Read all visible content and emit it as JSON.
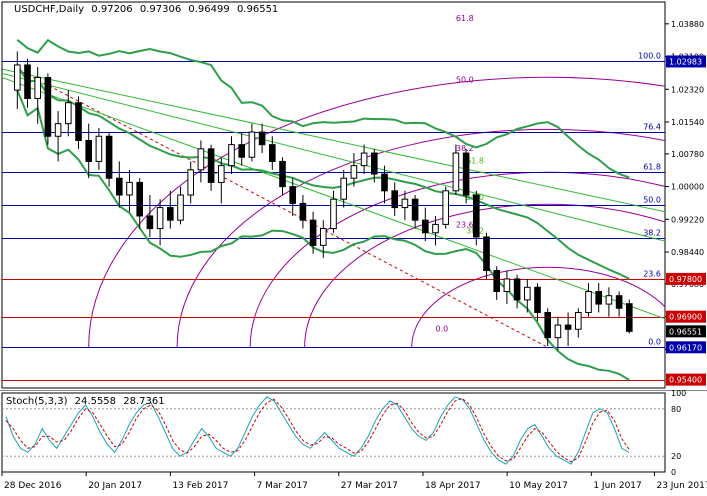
{
  "header": {
    "symbol": "USDCHF,Daily",
    "open": "0.97206",
    "high": "0.97306",
    "low": "0.96499",
    "close": "0.96551"
  },
  "stoch_header": {
    "name": "Stoch(5,3,3)",
    "main": "24.5558",
    "signal": "28.7361"
  },
  "colors": {
    "background": "#ffffff",
    "candle": "#000000",
    "bollinger": "#2e9e4a",
    "fan": "#33bb33",
    "fib_level": "#0000aa",
    "red_level": "#cc0000",
    "arc": "#990099",
    "stoch_main": "#1aa3b8",
    "stoch_signal": "#cc0000"
  },
  "chart_data": [
    {
      "type": "candlestick",
      "title": "USDCHF,Daily",
      "ylim": [
        0.952,
        1.044
      ],
      "price_ticks": [
        "1.03880",
        "1.03100",
        "1.02320",
        "1.01540",
        "1.00780",
        "1.00000",
        "0.99220",
        "0.98440",
        "0.97680",
        "0.96900",
        "0.96120"
      ],
      "x_ticks": [
        "28 Dec 2016",
        "20 Jan 2017",
        "13 Feb 2017",
        "7 Mar 2017",
        "27 Mar 2017",
        "18 Apr 2017",
        "10 May 2017",
        "1 Jun 2017",
        "23 Jun 2017"
      ],
      "horizontal_levels": [
        {
          "label": "100.0",
          "price": 1.02983,
          "tag": "1.02983",
          "kind": "fib"
        },
        {
          "label": "76.4",
          "price": 1.013,
          "kind": "fib"
        },
        {
          "label": "61.8",
          "price": 1.0035,
          "kind": "fib"
        },
        {
          "label": "50.0",
          "price": 0.9955,
          "kind": "fib"
        },
        {
          "label": "38.2",
          "price": 0.9877,
          "kind": "fib"
        },
        {
          "label": "23.6",
          "price": 0.978,
          "tag": "0.97800",
          "kind": "red"
        },
        {
          "label": "",
          "price": 0.969,
          "tag": "0.96900",
          "kind": "red"
        },
        {
          "label": "0.0",
          "price": 0.9617,
          "tag": "0.96170",
          "kind": "fib"
        },
        {
          "label": "",
          "price": 0.954,
          "tag": "0.95400",
          "kind": "red"
        }
      ],
      "current_price": "0.96551",
      "arc_labels": [
        {
          "label": "61.8",
          "x": 43,
          "price": 1.0395
        },
        {
          "label": "50.0",
          "x": 43,
          "price": 1.0248
        },
        {
          "label": "38.2",
          "x": 43,
          "price": 1.0085
        },
        {
          "label": "23.6",
          "x": 43,
          "price": 0.9903
        },
        {
          "label": "61.8",
          "x": 44,
          "price": 1.0055
        },
        {
          "label": "50.0",
          "x": 44,
          "price": 0.9968
        },
        {
          "label": "38.2",
          "x": 44,
          "price": 0.9888
        },
        {
          "label": "0.0",
          "x": 41,
          "price": 0.9655
        }
      ],
      "candles": [
        {
          "o": 1.023,
          "h": 1.0322,
          "l": 1.0185,
          "c": 1.029
        },
        {
          "o": 1.029,
          "h": 1.0305,
          "l": 1.0188,
          "c": 1.021
        },
        {
          "o": 1.021,
          "h": 1.0285,
          "l": 1.015,
          "c": 1.026
        },
        {
          "o": 1.026,
          "h": 1.027,
          "l": 1.01,
          "c": 1.012
        },
        {
          "o": 1.012,
          "h": 1.018,
          "l": 1.006,
          "c": 1.015
        },
        {
          "o": 1.015,
          "h": 1.023,
          "l": 1.012,
          "c": 1.02
        },
        {
          "o": 1.02,
          "h": 1.0215,
          "l": 1.009,
          "c": 1.011
        },
        {
          "o": 1.011,
          "h": 1.015,
          "l": 1.002,
          "c": 1.006
        },
        {
          "o": 1.006,
          "h": 1.014,
          "l": 1.004,
          "c": 1.012
        },
        {
          "o": 1.012,
          "h": 1.013,
          "l": 1.0,
          "c": 1.002
        },
        {
          "o": 1.002,
          "h": 1.006,
          "l": 0.995,
          "c": 0.998
        },
        {
          "o": 0.998,
          "h": 1.004,
          "l": 0.994,
          "c": 1.001
        },
        {
          "o": 1.001,
          "h": 1.002,
          "l": 0.99,
          "c": 0.993
        },
        {
          "o": 0.993,
          "h": 0.998,
          "l": 0.988,
          "c": 0.99
        },
        {
          "o": 0.99,
          "h": 0.997,
          "l": 0.986,
          "c": 0.995
        },
        {
          "o": 0.995,
          "h": 0.999,
          "l": 0.99,
          "c": 0.992
        },
        {
          "o": 0.992,
          "h": 1.0,
          "l": 0.991,
          "c": 0.998
        },
        {
          "o": 0.998,
          "h": 1.006,
          "l": 0.996,
          "c": 1.004
        },
        {
          "o": 1.004,
          "h": 1.011,
          "l": 1.001,
          "c": 1.009
        },
        {
          "o": 1.009,
          "h": 1.01,
          "l": 0.999,
          "c": 1.001
        },
        {
          "o": 1.001,
          "h": 1.007,
          "l": 0.996,
          "c": 1.005
        },
        {
          "o": 1.005,
          "h": 1.012,
          "l": 1.003,
          "c": 1.01
        },
        {
          "o": 1.01,
          "h": 1.013,
          "l": 1.005,
          "c": 1.007
        },
        {
          "o": 1.007,
          "h": 1.015,
          "l": 1.006,
          "c": 1.013
        },
        {
          "o": 1.013,
          "h": 1.015,
          "l": 1.008,
          "c": 1.01
        },
        {
          "o": 1.01,
          "h": 1.012,
          "l": 1.004,
          "c": 1.006
        },
        {
          "o": 1.006,
          "h": 1.007,
          "l": 0.998,
          "c": 1.0
        },
        {
          "o": 1.0,
          "h": 1.002,
          "l": 0.993,
          "c": 0.996
        },
        {
          "o": 0.996,
          "h": 0.998,
          "l": 0.99,
          "c": 0.992
        },
        {
          "o": 0.992,
          "h": 0.994,
          "l": 0.984,
          "c": 0.986
        },
        {
          "o": 0.986,
          "h": 0.992,
          "l": 0.983,
          "c": 0.99
        },
        {
          "o": 0.99,
          "h": 0.999,
          "l": 0.989,
          "c": 0.997
        },
        {
          "o": 0.997,
          "h": 1.004,
          "l": 0.995,
          "c": 1.002
        },
        {
          "o": 1.002,
          "h": 1.008,
          "l": 1.0,
          "c": 1.005
        },
        {
          "o": 1.005,
          "h": 1.01,
          "l": 1.003,
          "c": 1.008
        },
        {
          "o": 1.008,
          "h": 1.009,
          "l": 1.001,
          "c": 1.003
        },
        {
          "o": 1.003,
          "h": 1.005,
          "l": 0.996,
          "c": 0.999
        },
        {
          "o": 0.999,
          "h": 1.001,
          "l": 0.993,
          "c": 0.995
        },
        {
          "o": 0.995,
          "h": 0.999,
          "l": 0.992,
          "c": 0.997
        },
        {
          "o": 0.997,
          "h": 0.998,
          "l": 0.99,
          "c": 0.992
        },
        {
          "o": 0.992,
          "h": 0.995,
          "l": 0.987,
          "c": 0.989
        },
        {
          "o": 0.989,
          "h": 0.993,
          "l": 0.986,
          "c": 0.991
        },
        {
          "o": 0.991,
          "h": 1.0,
          "l": 0.99,
          "c": 0.999
        },
        {
          "o": 0.999,
          "h": 1.01,
          "l": 0.998,
          "c": 1.008
        },
        {
          "o": 1.008,
          "h": 1.009,
          "l": 0.996,
          "c": 0.998
        },
        {
          "o": 0.998,
          "h": 0.999,
          "l": 0.986,
          "c": 0.988
        },
        {
          "o": 0.988,
          "h": 0.989,
          "l": 0.978,
          "c": 0.98
        },
        {
          "o": 0.98,
          "h": 0.981,
          "l": 0.973,
          "c": 0.975
        },
        {
          "o": 0.975,
          "h": 0.98,
          "l": 0.972,
          "c": 0.978
        },
        {
          "o": 0.978,
          "h": 0.979,
          "l": 0.971,
          "c": 0.973
        },
        {
          "o": 0.973,
          "h": 0.978,
          "l": 0.97,
          "c": 0.976
        },
        {
          "o": 0.976,
          "h": 0.977,
          "l": 0.968,
          "c": 0.97
        },
        {
          "o": 0.97,
          "h": 0.971,
          "l": 0.962,
          "c": 0.964
        },
        {
          "o": 0.964,
          "h": 0.969,
          "l": 0.961,
          "c": 0.967
        },
        {
          "o": 0.967,
          "h": 0.97,
          "l": 0.962,
          "c": 0.966
        },
        {
          "o": 0.966,
          "h": 0.971,
          "l": 0.964,
          "c": 0.97
        },
        {
          "o": 0.97,
          "h": 0.977,
          "l": 0.969,
          "c": 0.975
        },
        {
          "o": 0.975,
          "h": 0.977,
          "l": 0.97,
          "c": 0.972
        },
        {
          "o": 0.972,
          "h": 0.976,
          "l": 0.969,
          "c": 0.974
        },
        {
          "o": 0.974,
          "h": 0.975,
          "l": 0.969,
          "c": 0.971
        },
        {
          "o": 0.9721,
          "h": 0.9731,
          "l": 0.965,
          "c": 0.9655
        }
      ]
    },
    {
      "type": "line",
      "title": "Stoch(5,3,3)",
      "ylim": [
        0,
        100
      ],
      "levels": [
        80,
        20
      ],
      "y_ticks": [
        "100",
        "80",
        "20",
        "0"
      ],
      "series": [
        {
          "name": "main",
          "values": [
            70,
            45,
            30,
            25,
            35,
            55,
            40,
            30,
            45,
            60,
            75,
            85,
            70,
            50,
            35,
            25,
            40,
            60,
            75,
            85,
            88,
            70,
            50,
            30,
            20,
            25,
            40,
            55,
            45,
            30,
            25,
            20,
            30,
            50,
            70,
            85,
            95,
            90,
            75,
            60,
            45,
            35,
            30,
            40,
            50,
            40,
            30,
            25,
            20,
            30,
            45,
            65,
            80,
            90,
            85,
            70,
            55,
            45,
            40,
            50,
            70,
            85,
            95,
            92,
            80,
            60,
            40,
            25,
            15,
            10,
            20,
            40,
            55,
            60,
            45,
            30,
            20,
            15,
            10,
            25,
            50,
            75,
            80,
            75,
            55,
            30,
            24.6
          ]
        },
        {
          "name": "signal",
          "values": [
            65,
            55,
            40,
            30,
            32,
            45,
            45,
            38,
            40,
            52,
            68,
            80,
            75,
            60,
            45,
            32,
            35,
            50,
            68,
            80,
            85,
            78,
            60,
            40,
            28,
            24,
            32,
            45,
            48,
            40,
            30,
            25,
            27,
            40,
            58,
            75,
            88,
            92,
            82,
            68,
            52,
            40,
            34,
            36,
            45,
            43,
            35,
            30,
            24,
            26,
            38,
            55,
            72,
            85,
            87,
            78,
            62,
            50,
            43,
            45,
            60,
            77,
            90,
            93,
            85,
            68,
            48,
            32,
            20,
            14,
            16,
            30,
            45,
            55,
            50,
            38,
            26,
            18,
            13,
            18,
            38,
            62,
            76,
            78,
            65,
            42,
            28.7
          ]
        }
      ]
    }
  ]
}
